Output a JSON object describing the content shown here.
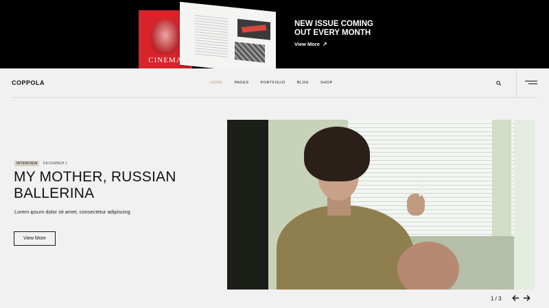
{
  "promo": {
    "cover_title": "CINEMA",
    "headline": "NEW ISSUE COMING OUT EVERY MONTH",
    "link_label": "View More",
    "link_icon": "arrow-up-right-icon"
  },
  "header": {
    "logo": "COPPOLA",
    "nav": [
      {
        "label": "HOME",
        "active": true
      },
      {
        "label": "PAGES",
        "active": false
      },
      {
        "label": "PORTFOLIO",
        "active": false
      },
      {
        "label": "BLOG",
        "active": false
      },
      {
        "label": "SHOP",
        "active": false
      }
    ],
    "search_icon": "search-icon",
    "menu_icon": "hamburger-menu-icon"
  },
  "hero": {
    "category": "INTERVIEW",
    "date": "DECEMBER 1",
    "title": "MY MOTHER, RUSSIAN BALLERINA",
    "subtitle": "Lorem ipsum dolor sit amet, consectetur adipiscing",
    "button_label": "View More"
  },
  "slider": {
    "counter": "1 / 3",
    "prev_icon": "arrow-left-icon",
    "next_icon": "arrow-right-icon"
  },
  "colors": {
    "accent": "#c99a75",
    "banner_bg": "#000000",
    "page_bg": "#f1f1f1",
    "cover_red": "#d8232a"
  }
}
